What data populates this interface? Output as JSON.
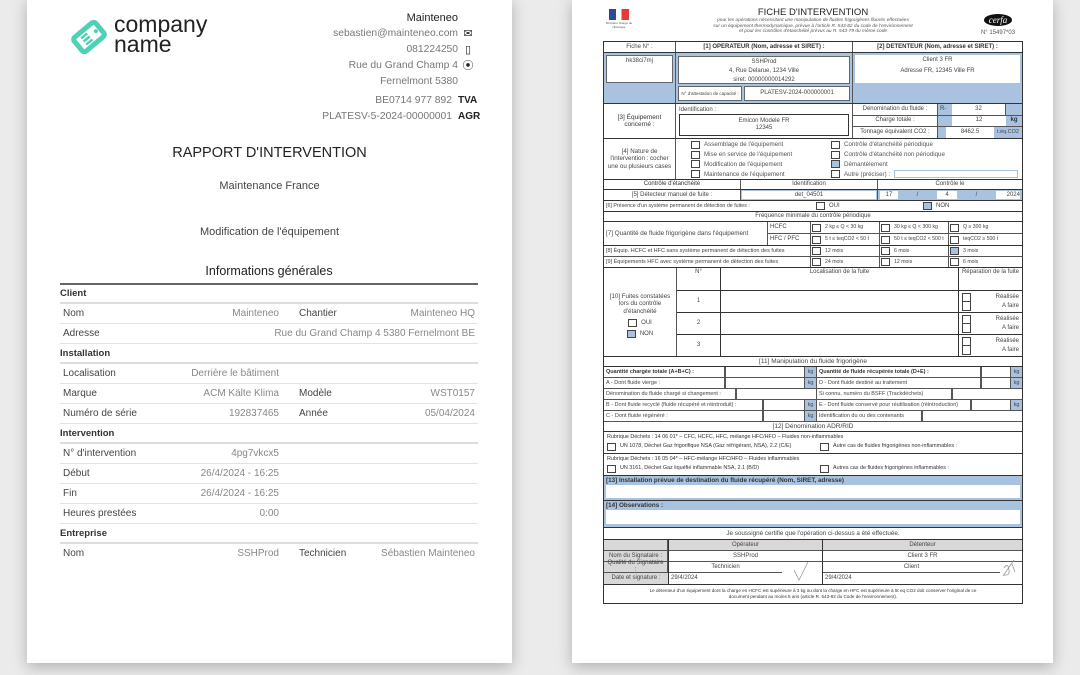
{
  "report": {
    "logo_text_line1": "company",
    "logo_text_line2": "name",
    "company": {
      "name": "Mainteneo",
      "email": "sebastien@mainteneo.com",
      "phone": "081224250",
      "street": "Rue du Grand Champ 4",
      "city": "Fernelmont 5380",
      "vat": "BE0714 977 892",
      "vat_tag": "TVA",
      "agreement": "PLATESV-5-2024-00000001",
      "agreement_tag": "AGR",
      "icons": {
        "email": "envelope-icon",
        "phone": "mobile-phone-icon",
        "address": "map-pin-icon"
      }
    },
    "title": "RAPPORT D'INTERVENTION",
    "subtitle": "Maintenance France",
    "intervention_type": "Modification de l'équipement",
    "section_title": "Informations générales",
    "groups": {
      "client": {
        "label": "Client",
        "nom_k": "Nom",
        "nom_v": "Mainteneo",
        "chantier_k": "Chantier",
        "chantier_v": "Mainteneo HQ",
        "adresse_k": "Adresse",
        "adresse_v": "Rue du Grand Champ 4 5380 Fernelmont BE"
      },
      "installation": {
        "label": "Installation",
        "loc_k": "Localisation",
        "loc_v": "Derrière le bâtiment",
        "marque_k": "Marque",
        "marque_v": "ACM Kälte Klima",
        "modele_k": "Modèle",
        "modele_v": "WST0157",
        "serie_k": "Numéro de série",
        "serie_v": "192837465",
        "annee_k": "Année",
        "annee_v": "05/04/2024"
      },
      "intervention": {
        "label": "Intervention",
        "num_k": "N° d'intervention",
        "num_v": "4pg7vkcx5",
        "debut_k": "Début",
        "debut_v": "26/4/2024 - 16:25",
        "fin_k": "Fin",
        "fin_v": "26/4/2024 - 16:25",
        "heures_k": "Heures prestées",
        "heures_v": "0:00"
      },
      "entreprise": {
        "label": "Entreprise",
        "nom_k": "Nom",
        "nom_v": "SSHProd",
        "tech_k": "Technicien",
        "tech_v": "Sébastien Mainteneo"
      }
    }
  },
  "cerfa": {
    "ministry_text": "Ministère chargé de l'Écologie",
    "title": "FICHE D'INTERVENTION",
    "subtitle_1": "pour les opérations nécessitant une manipulation de fluides frigorigènes fluorés effectuées",
    "subtitle_2": "sur un équipement thermodynamique, prévue à l'article R. 543-82 du code de l'environnement",
    "subtitle_3": "et pour les contrôles d'étanchéité prévus au R. 543-79 du même code",
    "cerfa_logo": "cerfa",
    "cerfa_number": "N° 15497*03",
    "fiche_label": "Fiche N° :",
    "fiche_value": "hk38ci7mj",
    "operateur_label": "[1] OPERATEUR (Nom, adresse et SIRET) :",
    "operateur_name": "SSHProd",
    "operateur_address": "4, Rue Delarue, 1234 Ville",
    "operateur_siret": "siret: 00000000014292",
    "attestation_label": "N° d'attestation de capacité :",
    "attestation_value": "PLATESV-2024-000000001",
    "detenteur_label": "[2] DETENTEUR (Nom, adresse et SIRET) :",
    "detenteur_name": "Client 3 FR",
    "detenteur_address": "Adresse FR, 12345 Ville FR",
    "equipement_label": "[3] Équipement concerné :",
    "identification_label": "Identification :",
    "identification_value_1": "Emicon Modele FR",
    "identification_value_2": "12345",
    "fluide_label": "Dénomination du fluide :",
    "fluide_prefix": "R-",
    "fluide_value": "32",
    "charge_label": "Charge totale :",
    "charge_value": "12",
    "charge_unit": "kg",
    "tonnage_label": "Tonnage équivalent CO2 :",
    "tonnage_value": "8462.5",
    "tonnage_unit": "t.éq.CO2",
    "nature_label": "[4] Nature de l'intervention : cocher une ou plusieurs cases",
    "nature_options": [
      {
        "label": "Assemblage de l'équipement",
        "checked": false
      },
      {
        "label": "Mise en service de l'équipement",
        "checked": false
      },
      {
        "label": "Modification de l'équipement",
        "checked": false
      },
      {
        "label": "Maintenance de l'équipement",
        "checked": false
      },
      {
        "label": "Contrôle d'étanchéité périodique",
        "checked": false
      },
      {
        "label": "Contrôle d'étanchéité non périodique",
        "checked": false
      },
      {
        "label": "Démantèlement",
        "checked": true
      },
      {
        "label": "Autre (préciser) :",
        "checked": false
      }
    ],
    "etancheite_header": "Contrôle d'étanchéité",
    "identification_header": "Identification",
    "controle_le_header": "Contrôle le",
    "detecteur_label": "[5] Détecteur manuel de fuite :",
    "detecteur_value": "det_04501",
    "controle_day": "17",
    "controle_month": "4",
    "controle_year": "2024",
    "date_sep": "/",
    "systeme_label": "[6] Présence d'un système permanent de détection de fuites :",
    "oui": "OUI",
    "non": "NON",
    "systeme_oui": false,
    "systeme_non": true,
    "frequence_header": "Fréquence minimale du contrôle périodique",
    "quantite_label": "[7] Quantité de fluide frigorigène dans l'équipement",
    "hcfc": "HCFC",
    "hfc_pfc": "HFC / PFC",
    "hcfc_options": [
      "2 kg ≤ Q < 30 kg",
      "30 kg ≤ Q < 300 kg",
      "Q ≥ 300 kg"
    ],
    "hfc_options": [
      "5 t ≤ teqCO2 < 50 t",
      "50 t ≤ teqCO2 < 500 t",
      "teqCO2 ≥ 500 t"
    ],
    "equip8_label": "[8] Équip. HCFC et HFC sans système permanent de détection des fuites",
    "equip8_options": [
      {
        "label": "12 mois",
        "checked": false
      },
      {
        "label": "6 mois",
        "checked": false
      },
      {
        "label": "3 mois",
        "checked": true
      }
    ],
    "equip9_label": "[9] Équipements HFC avec système permanent de détection des fuites",
    "equip9_options": [
      {
        "label": "24 mois",
        "checked": false
      },
      {
        "label": "12 mois",
        "checked": false
      },
      {
        "label": "6 mois",
        "checked": false
      }
    ],
    "fuites_label": "[10] Fuites constatées lors du contrôle d'étanchéité",
    "fuites_oui": false,
    "fuites_non": true,
    "num_header": "N°",
    "localisation_header": "Localisation de la fuite",
    "reparation_header": "Réparation de la fuite",
    "realisee": "Réalisée",
    "a_faire": "A faire",
    "fuite_rows": [
      "1",
      "2",
      "3"
    ],
    "manip_header": "[11] Manipulation du fluide frigorigène",
    "qte_chargee": "Quantité chargée totale (A+B+C) :",
    "qte_recuperee": "Quantité de fluide récupérée totale (D+E) :",
    "a_vierge": "A - Dont fluide vierge :",
    "d_traitement": "D - Dont fluide destiné au traitement",
    "denomination_chargee": "Dénomination du fluide chargé si changement :",
    "bsff": "Si connu, numéro du BSFF (Trackdéchets)",
    "b_recycle": "B - Dont fluide recyclé (fluide récupéré et réintroduit) :",
    "e_conserve": "E - Dont fluide conservé pour réutilisation (réintroduction)",
    "c_regenere": "C - Dont fluide régénéré :",
    "contenants": "Identification du ou des contenants",
    "kg": "kg",
    "adr_header": "[12] Dénomination ADR/RID",
    "rubrique1": "Rubrique Déchets : 14 06 01* – CFC, HCFC, HFC, mélange HFC/HFO – Fluides non-inflammables",
    "un1078": "UN 1078, Déchet Gaz frigorifique NSA (Gaz réfrigérant, NSA), 2.2 (C/E)",
    "autre_non_inflam": "Autre cas de fluides frigorigènes non-inflammables :",
    "rubrique2": "Rubrique Déchets : 16 05 04* – HFC-mélange HFC/HFO – Fluides inflammables",
    "un3161": "UN 3161, Déchet Gaz liquéfié inflammable NSA, 2.1 (B/D)",
    "autre_inflam": "Autres cas de fluides frigorigènes inflammables :",
    "destination_label": "[13] Installation prévue de destination du fluide récupéré (Nom, SIRET, adresse)",
    "observations_label": "[14] Observations :",
    "certify": "Je soussigné certifie que l'opération ci-dessus a été effectuée.",
    "operateur_col": "Opérateur",
    "detenteur_col": "Détenteur",
    "nom_signataire": "Nom du Signataire :",
    "qualite_signataire": "Qualité du Signataire :",
    "date_signature": "Date et signature :",
    "sig_op_name": "SSHProd",
    "sig_op_quality": "Technicien",
    "sig_op_date": "29/4/2024",
    "sig_det_name": "Client 3 FR",
    "sig_det_quality": "Client",
    "sig_det_date": "29/4/2024",
    "footer_1": "Le détenteur d'un équipement dont la charge en HCFC est supérieure à 3 kg ou dont la charge en HFC est supérieure à 5t eq CO2 doit conserver l'original de ce",
    "footer_2": "document pendant au moins 5 ans (article R. 543-82 du Code de l'environnement)."
  },
  "colors": {
    "accent": "#4fd1b5",
    "form_blue": "#a9c2e0"
  }
}
